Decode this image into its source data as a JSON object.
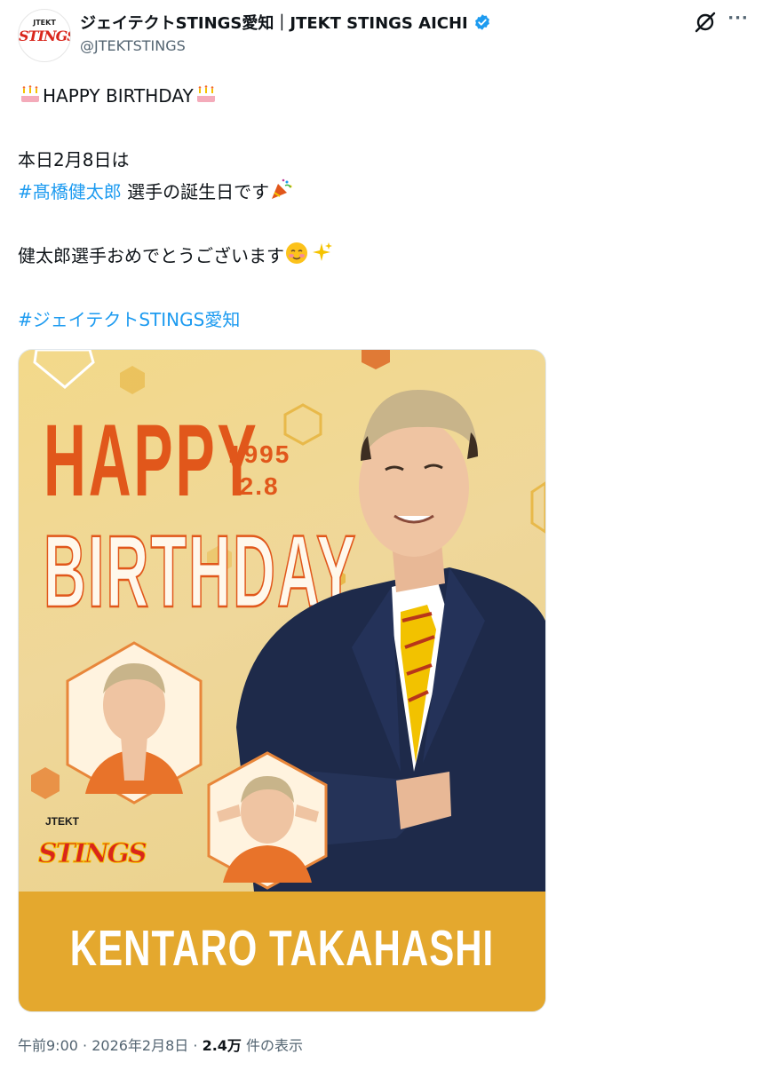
{
  "account": {
    "display_name": "ジェイテクトSTINGS愛知｜JTEKT STINGS AICHI",
    "handle": "@JTEKTSTINGS",
    "avatar_text_top": "JTEKT",
    "avatar_text_main": "STINGS"
  },
  "tweet": {
    "line1": "HAPPY BIRTHDAY",
    "line2": "本日2月8日は",
    "hashtag1": "#髙橋健太郎",
    "line3_rest": " 選手の誕生日です",
    "line4": "健太郎選手おめでとうございます",
    "hashtag2": "#ジェイテクトSTINGS愛知"
  },
  "image": {
    "happy": "HAPPY",
    "birthday": "BIRTHDAY",
    "year": "1995",
    "date": "2.8",
    "name": "KENTARO TAKAHASHI",
    "logo_top": "JTEKT",
    "logo_main": "STINGS"
  },
  "meta": {
    "time": "午前9:00",
    "separator1": " · ",
    "date": "2026年2月8日",
    "separator2": " · ",
    "views_count": "2.4万",
    "views_label": " 件の表示"
  },
  "colors": {
    "link": "#1d9bf0",
    "verified": "#1d9bf0",
    "accent_orange": "#e1571b",
    "band_gold": "#e4a82e"
  },
  "icons": [
    "verified-badge-icon",
    "grok-icon",
    "more-icon",
    "cake-emoji",
    "party-popper-emoji",
    "smiling-face-emoji",
    "sparkles-emoji"
  ]
}
